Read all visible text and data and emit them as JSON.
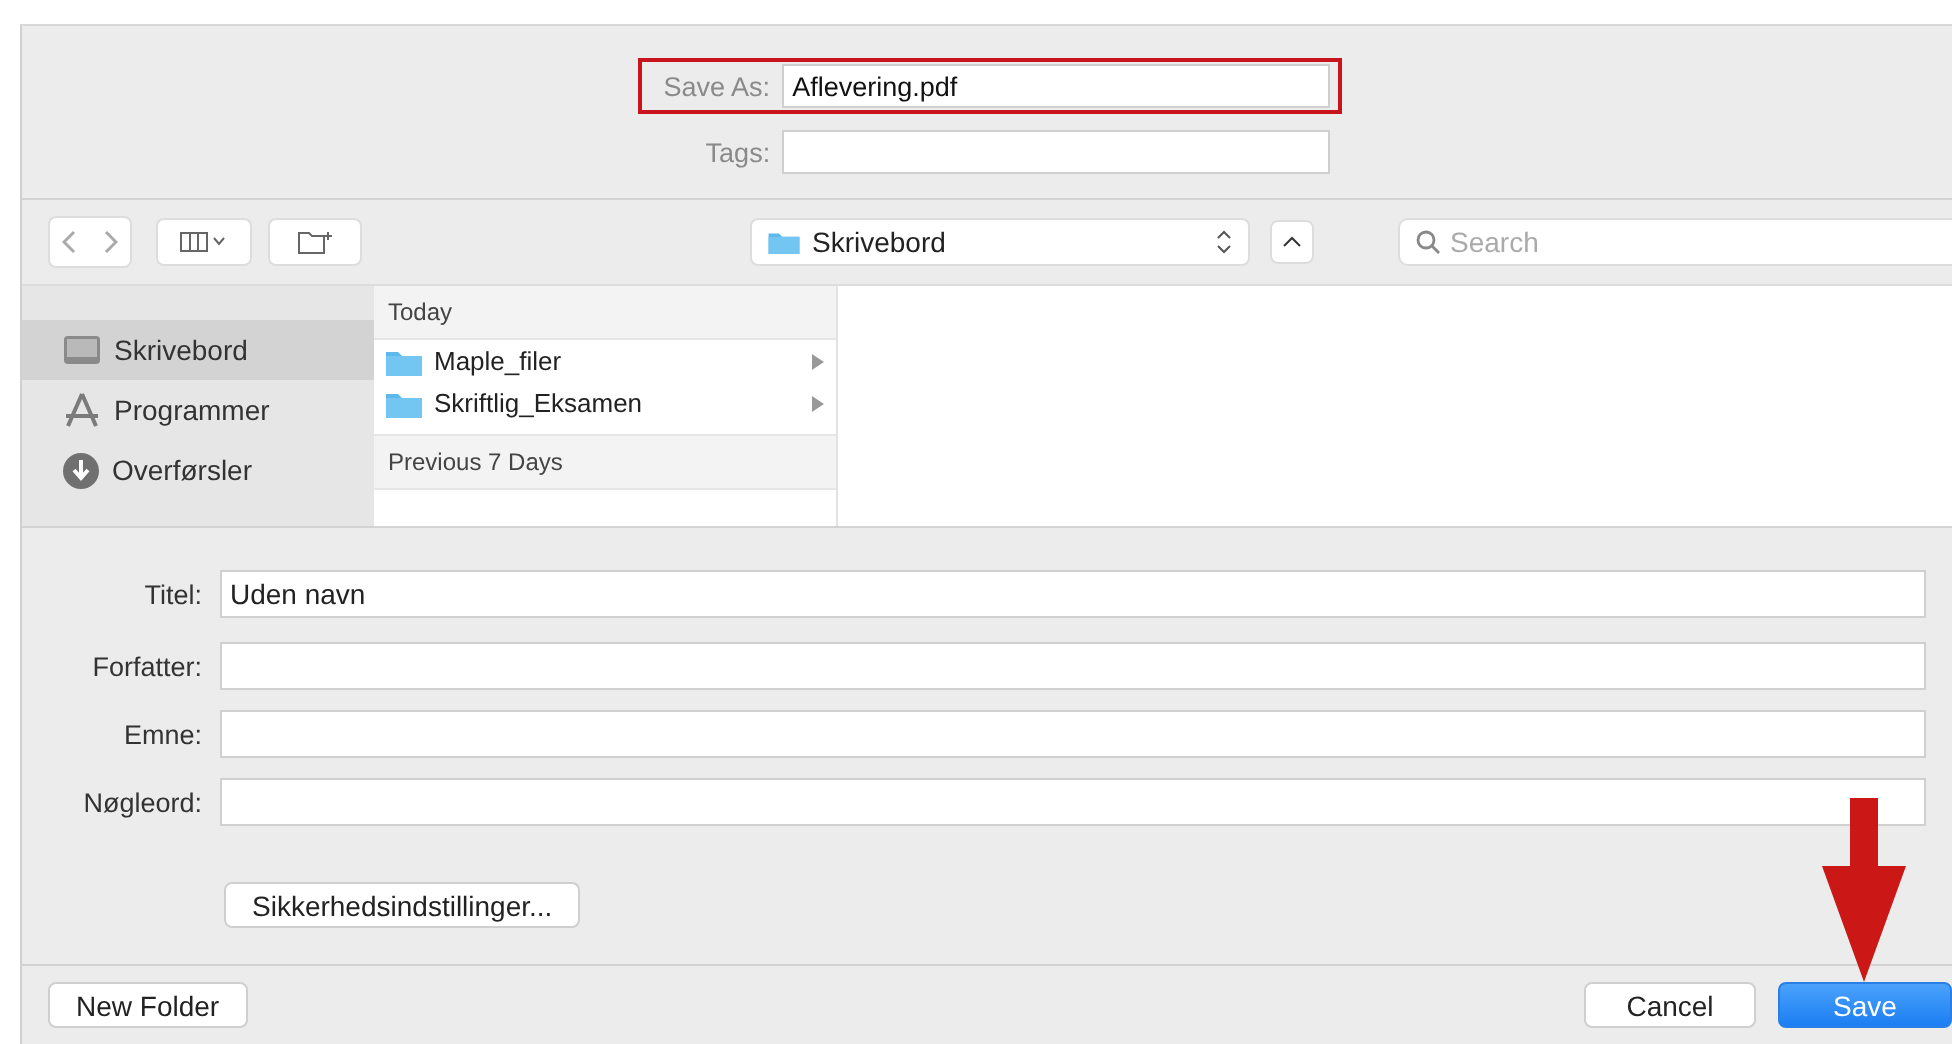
{
  "save_as": {
    "label": "Save As:",
    "value": "Aflevering.pdf",
    "highlighted": true
  },
  "tags": {
    "label": "Tags:"
  },
  "toolbar": {
    "location": "Skrivebord",
    "search_placeholder": "Search"
  },
  "sidebar": {
    "items": [
      {
        "label": "Skrivebord",
        "kind": "desktop",
        "selected": true
      },
      {
        "label": "Programmer",
        "kind": "apps",
        "selected": false
      },
      {
        "label": "Overførsler",
        "kind": "download",
        "selected": false
      }
    ]
  },
  "browser": {
    "groups": [
      {
        "title": "Today",
        "items": [
          {
            "name": "Maple_filer",
            "kind": "folder"
          },
          {
            "name": "Skriftlig_Eksamen",
            "kind": "folder"
          }
        ]
      },
      {
        "title": "Previous 7 Days"
      }
    ]
  },
  "metadata": [
    {
      "label": "Titel:",
      "value": "Uden navn"
    },
    {
      "label": "Forfatter:"
    },
    {
      "label": "Emne:"
    },
    {
      "label": "Nøgleord:"
    }
  ],
  "security_button": "Sikkerhedsindstillinger...",
  "buttons": [
    {
      "label": "New Folder",
      "kind": "secondary"
    },
    {
      "label": "Cancel",
      "kind": "secondary"
    },
    {
      "label": "Save",
      "kind": "default"
    }
  ],
  "arrow_to_save": true
}
